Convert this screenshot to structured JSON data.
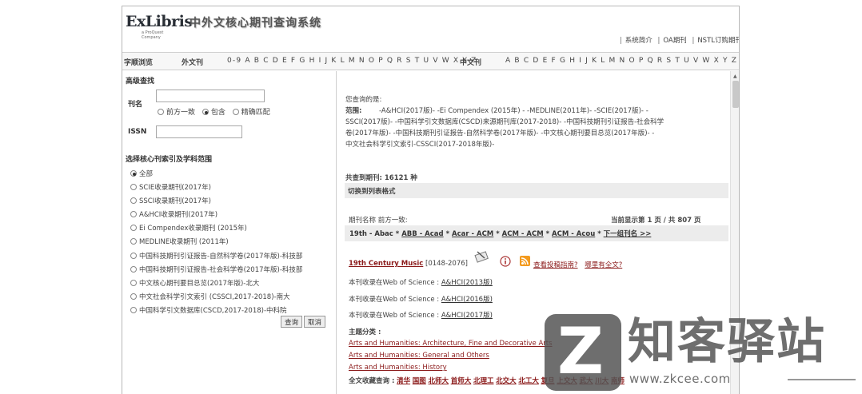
{
  "header": {
    "logo_main": "ExLibris",
    "logo_sub": "a ProQuest Company",
    "system_title": "中外文核心期刊查询系统",
    "top_links": [
      "系统简介",
      "OA期刊",
      "NSTL订购期刊"
    ]
  },
  "alphabar": {
    "browse_label": "字顺浏览",
    "foreign_label": "外文刊",
    "foreign_letters": "0-9 A B C D E F G H I J K L M N O P Q R S T U V W X Y Z",
    "chinese_label": "中文刊",
    "chinese_letters": "A B C D E F G H I J K L M N O P Q R S T U V W X Y Z"
  },
  "search": {
    "title": "高级查找",
    "journal_label": "刊名",
    "journal_value": "",
    "match_options": [
      "前方一致",
      "包含",
      "精确匹配"
    ],
    "match_selected": "包含",
    "issn_label": "ISSN",
    "issn_value": "",
    "category_title": "选择核心刊索引及学科范围",
    "categories": [
      "全部",
      "SCIE收录期刊(2017年)",
      "SSCI收录期刊(2017年)",
      "A&HCI收录期刊(2017年)",
      "Ei Compendex收录期刊 (2015年)",
      "MEDLINE收录期刊 (2011年)",
      "中国科技期刊引证报告-自然科学卷(2017年版)-科技部",
      "中国科技期刊引证报告-社会科学卷(2017年版)-科技部",
      "中文核心期刊要目总览(2017年版)-北大",
      "中文社会科学引文索引 (CSSCI,2017-2018)-南大",
      "中国科学引文数据库(CSCD,2017-2018)-中科院"
    ],
    "category_selected": "全部",
    "query_button": "查询",
    "cancel_button": "取消"
  },
  "results": {
    "query_heading": "您查询的是:",
    "scope_label": "范围:",
    "scope_lines": [
      "-A&HCI(2017版)-     -Ei Compendex (2015年) -     -MEDLINE(2011年)-     -SCIE(2017版)-     -",
      "SSCI(2017版)-     -中国科学引文数据库(CSCD)来源期刊库(2017-2018)-     -中国科技期刊引证报告-社会科学",
      "卷(2017年版)-     -中国科技期刊引证报告-自然科学卷(2017年版)-     -中文核心期刊要目总览(2017年版)-     -",
      "中文社会科学引文索引-CSSCI(2017-2018年版)-"
    ],
    "total_text": "共查到期刊: 16121 种",
    "switch_view": "切换到列表格式",
    "prefix_label": "期刊名称 前方一致:",
    "page_info": "当前显示第 1 页 / 共 807 页",
    "range_current": "19th - Abac",
    "range_links": [
      "ABB - Acad",
      "Acar - ACM",
      "ACM - ACM",
      "ACM - Acou"
    ],
    "next_group": "下一组刊名 >>",
    "journal_title": "19th Century Music",
    "journal_issn": "[0148-2076]",
    "guide_link": "查看投稿指南?",
    "fulltext_link": "哪里有全文?",
    "wos_label": "本刊收录在Web of Science :",
    "wos_entries": [
      "A&HCI(2013版)",
      "A&HCI(2016版)",
      "A&HCI(2017版)"
    ],
    "subject_label": "主题分类 :",
    "subjects": [
      "Arts and Humanities: Architecture, Fine and Decorative Arts",
      "Arts and Humanities: General and Others",
      "Arts and Humanities: History"
    ],
    "fulltext_label": "全文收藏查询 :",
    "libraries": [
      "清华",
      "国图",
      "北师大",
      "首师大",
      "北理工",
      "北交大",
      "北工大",
      "复旦",
      "上交大",
      "武大",
      "川大",
      "南师"
    ]
  },
  "watermark": {
    "logo_letter": "Z",
    "brand": "知客驿站",
    "url": "www.zkcee.com"
  }
}
